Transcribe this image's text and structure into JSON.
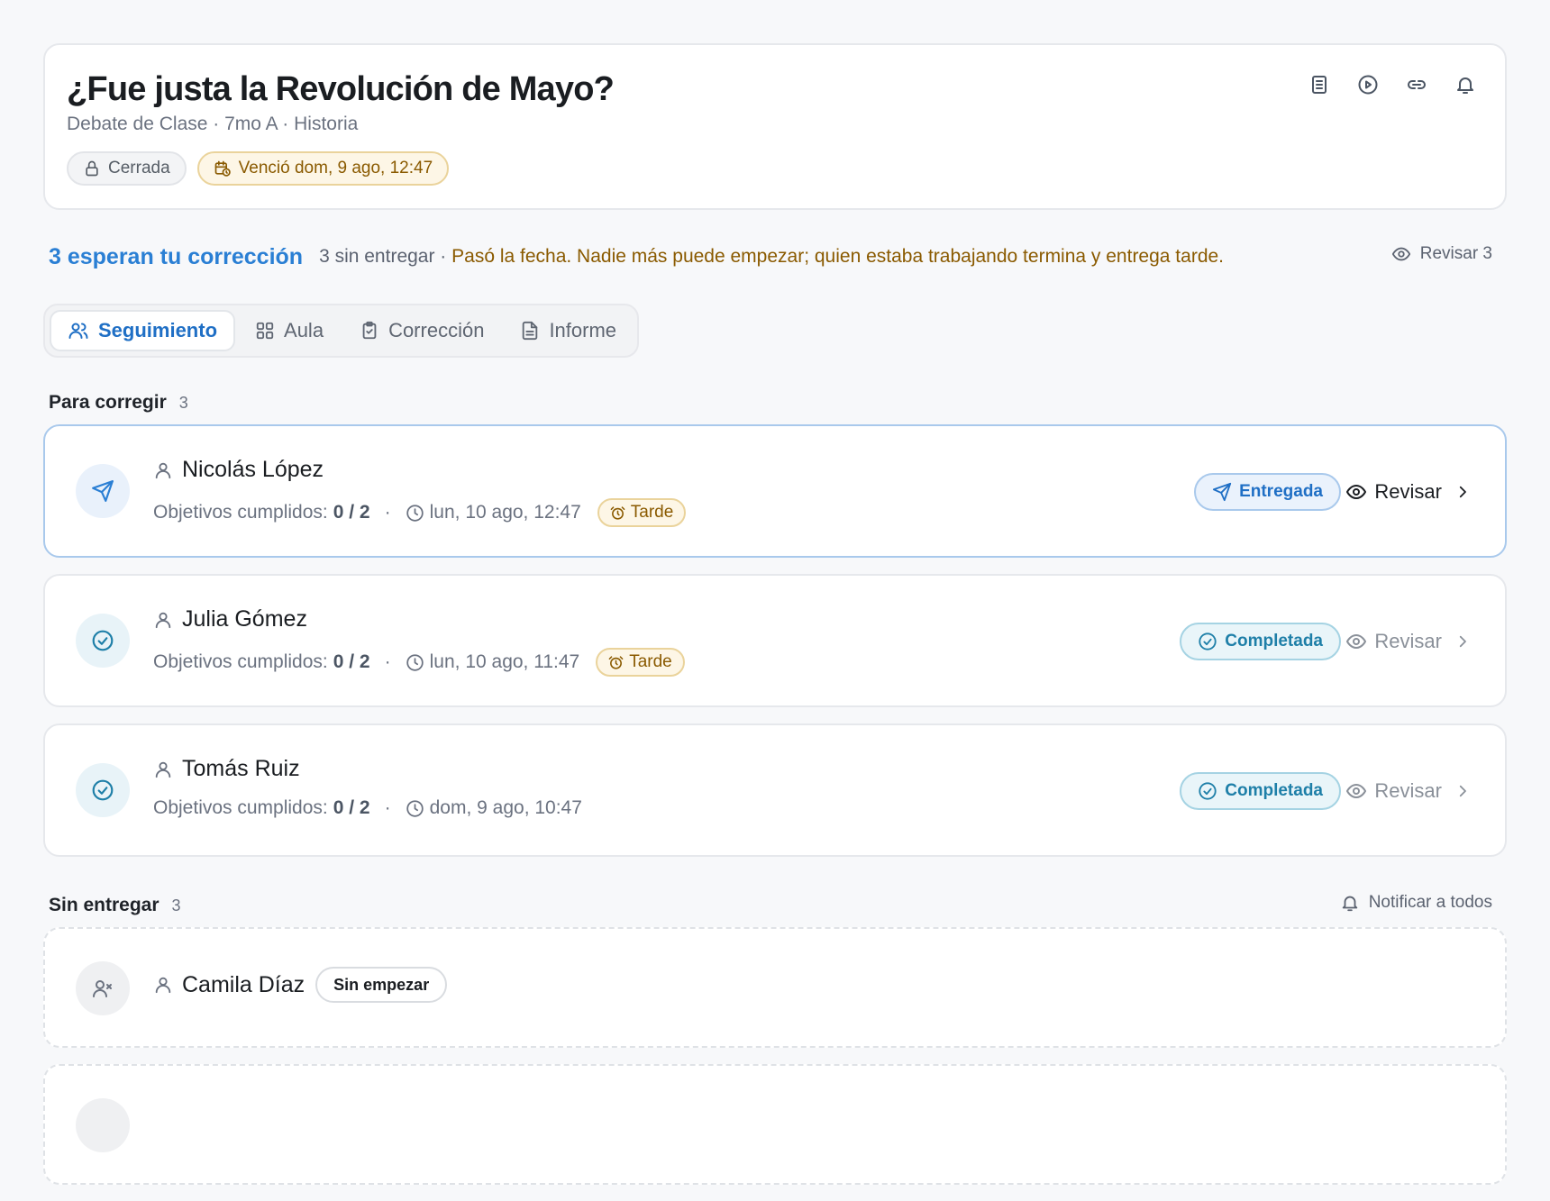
{
  "header": {
    "title": "¿Fue justa la Revolución de Mayo?",
    "subtitle": "Debate de Clase · 7mo A · Historia",
    "chip_closed": "Cerrada",
    "chip_due": "Venció dom, 9 ago, 12:47",
    "icons": [
      "document-icon",
      "play-icon",
      "link-icon",
      "bell-icon"
    ]
  },
  "summary": {
    "pending": "3 esperan tu corrección",
    "not_submitted": "3 sin entregar · ",
    "warning": "Pasó la fecha. Nadie más puede empezar; quien estaba trabajando termina y entrega tarde.",
    "review_all": "Revisar 3"
  },
  "tabs": [
    {
      "label": "Seguimiento",
      "active": true
    },
    {
      "label": "Aula",
      "active": false
    },
    {
      "label": "Corrección",
      "active": false
    },
    {
      "label": "Informe",
      "active": false
    }
  ],
  "to_grade": {
    "heading": "Para corregir",
    "count": "3",
    "objectives_label": "Objetivos cumplidos:",
    "items": [
      {
        "name": "Nicolás López",
        "objectives": "0 / 2",
        "time": "lun, 10 ago, 12:47",
        "late": "Tarde",
        "status": "Entregada",
        "action": "Revisar"
      },
      {
        "name": "Julia Gómez",
        "objectives": "0 / 2",
        "time": "lun, 10 ago, 11:47",
        "late": "Tarde",
        "status": "Completada",
        "action": "Revisar"
      },
      {
        "name": "Tomás Ruiz",
        "objectives": "0 / 2",
        "time": "dom, 9 ago, 10:47",
        "late": "",
        "status": "Completada",
        "action": "Revisar"
      }
    ]
  },
  "not_submitted": {
    "heading": "Sin entregar",
    "count": "3",
    "notify_all": "Notificar a todos",
    "items": [
      {
        "name": "Camila Díaz",
        "status": "Sin empezar"
      }
    ]
  },
  "colors": {
    "accent": "#2a7fd4",
    "warning": "#8a5a00",
    "completed": "#1e7fa8"
  }
}
